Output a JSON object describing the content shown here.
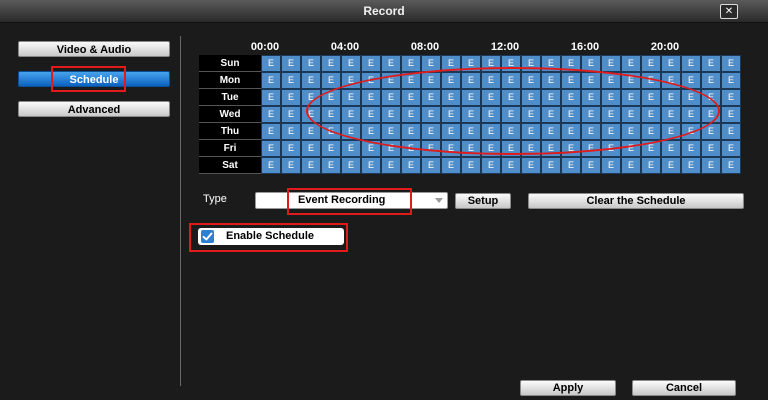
{
  "window": {
    "title": "Record",
    "close_glyph": "✕"
  },
  "sidebar": {
    "items": [
      {
        "label": "Video & Audio",
        "active": false
      },
      {
        "label": "Schedule",
        "active": true
      },
      {
        "label": "Advanced",
        "active": false
      }
    ]
  },
  "schedule": {
    "hour_labels": [
      "00:00",
      "04:00",
      "08:00",
      "12:00",
      "16:00",
      "20:00"
    ],
    "days": [
      "Sun",
      "Mon",
      "Tue",
      "Wed",
      "Thu",
      "Fri",
      "Sat"
    ],
    "cell_mark": "E",
    "slots_per_day": 24
  },
  "controls": {
    "type_label": "Type",
    "type_value": "Event Recording",
    "setup_label": "Setup",
    "clear_label": "Clear the Schedule",
    "enable_label": "Enable Schedule",
    "enable_checked": true
  },
  "footer": {
    "apply_label": "Apply",
    "cancel_label": "Cancel"
  },
  "colors": {
    "accent": "#0d62bd",
    "cell": "#4f8ec9",
    "highlight": "#e01b1b"
  },
  "icons": {
    "close": "close-icon",
    "dropdown": "chevron-down-icon",
    "check": "check-icon"
  }
}
